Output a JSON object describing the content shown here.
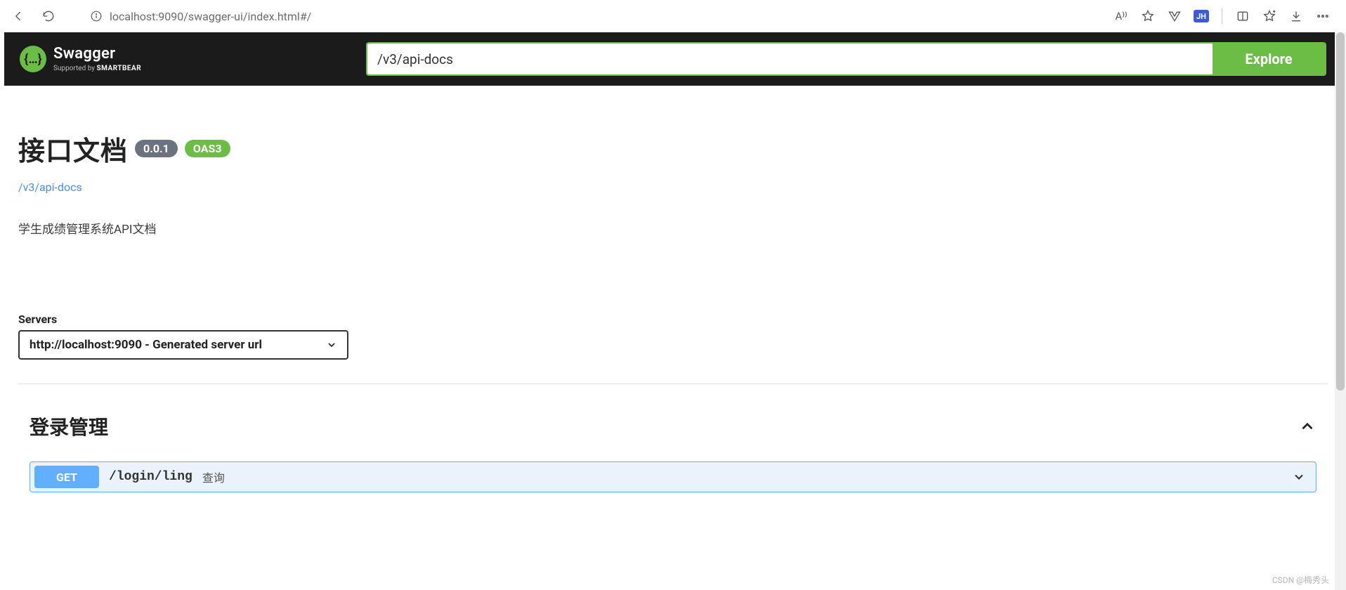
{
  "browser": {
    "url_host": "localhost",
    "url_port": ":9090",
    "url_path": "/swagger-ui/index.html#/",
    "read_aloud_label": "A⁾⁾",
    "ext_badge": "JH"
  },
  "topbar": {
    "logo_glyph": "{…}",
    "logo_text": "Swagger",
    "logo_sub_prefix": "Supported by ",
    "logo_sub_brand": "SMARTBEAR",
    "input_value": "/v3/api-docs",
    "explore_label": "Explore"
  },
  "info": {
    "title": "接口文档",
    "version": "0.0.1",
    "oas_badge": "OAS3",
    "docs_link": "/v3/api-docs",
    "description": "学生成绩管理系统API文档"
  },
  "servers": {
    "label": "Servers",
    "selected": "http://localhost:9090 - Generated server url"
  },
  "tag": {
    "name": "登录管理",
    "ops": [
      {
        "method": "GET",
        "path": "/login/ling",
        "summary": "查询"
      }
    ]
  },
  "watermark": "CSDN @梅秀头"
}
